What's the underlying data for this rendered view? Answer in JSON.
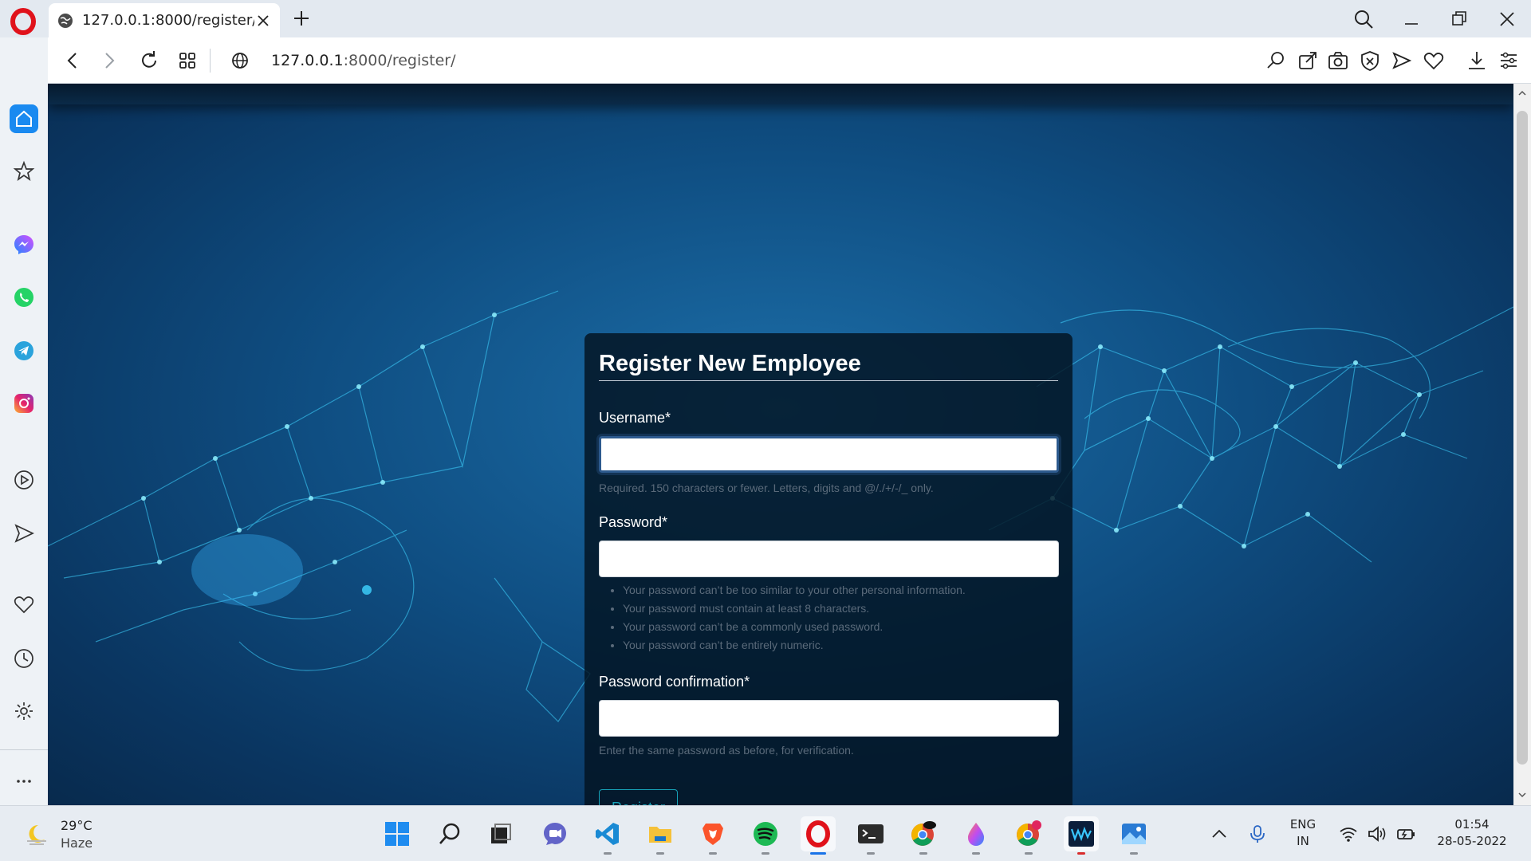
{
  "browser": {
    "tab_title": "127.0.0.1:8000/register/",
    "url_host": "127.0.0.1",
    "url_rest": ":8000/register/"
  },
  "form": {
    "title": "Register New Employee",
    "username_label": "Username*",
    "username_value": "",
    "username_help": "Required. 150 characters or fewer. Letters, digits and @/./+/-/_ only.",
    "password_label": "Password*",
    "password_value": "",
    "password_help": [
      "Your password can’t be too similar to your other personal information.",
      "Your password must contain at least 8 characters.",
      "Your password can’t be a commonly used password.",
      "Your password can’t be entirely numeric."
    ],
    "password2_label": "Password confirmation*",
    "password2_value": "",
    "password2_help": "Enter the same password as before, for verification.",
    "submit_label": "Register"
  },
  "taskbar": {
    "weather_temp": "29°C",
    "weather_desc": "Haze",
    "lang_line1": "ENG",
    "lang_line2": "IN",
    "time": "01:54",
    "date": "28-05-2022"
  },
  "colors": {
    "accent": "#17a2b8",
    "card_bg": "#031220",
    "sidebar_active": "#1a8af0"
  }
}
